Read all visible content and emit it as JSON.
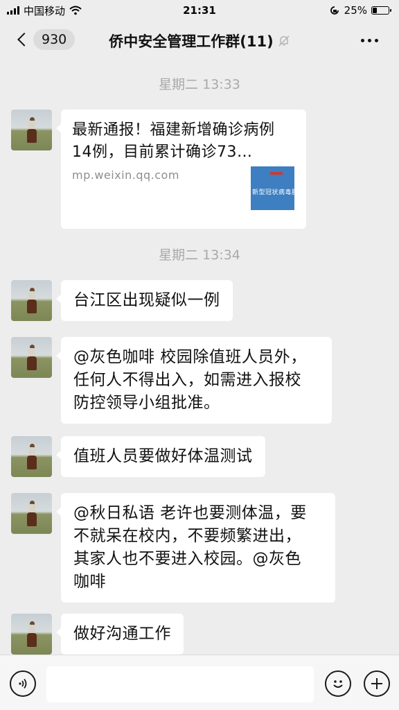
{
  "status_bar": {
    "carrier": "中国移动",
    "time": "21:31",
    "battery": "25%",
    "battery_level": 0.25
  },
  "nav": {
    "back_count": "930",
    "title": "侨中安全管理工作群(11)"
  },
  "messages": [
    {
      "type": "time",
      "text": "星期二 13:33"
    },
    {
      "type": "link",
      "title": "最新通报！福建新增确诊病例14例，目前累计确诊73…",
      "source": "mp.weixin.qq.com",
      "thumb_text": "新型冠状病毒肺炎"
    },
    {
      "type": "time",
      "text": "星期二 13:34"
    },
    {
      "type": "text",
      "text": "台江区出现疑似一例"
    },
    {
      "type": "text",
      "lines": [
        "@灰色咖啡 校园除值班人员外，",
        "任何人不得出入，如需进入报校",
        "防控领导小组批准。"
      ]
    },
    {
      "type": "text",
      "text": "值班人员要做好体温测试"
    },
    {
      "type": "text",
      "lines": [
        "@秋日私语 老许也要测体温，要",
        "不就呆在校内，不要频繁进出，",
        "其家人也不要进入校园。@灰色",
        "咖啡"
      ]
    },
    {
      "type": "text",
      "text": "做好沟通工作"
    }
  ],
  "icons": {
    "voice": "voice-icon",
    "emoji": "emoji-icon",
    "plus": "plus-icon",
    "mute": "mute-bell-icon",
    "wifi": "wifi-icon",
    "orientation_lock": "orientation-lock-icon"
  }
}
